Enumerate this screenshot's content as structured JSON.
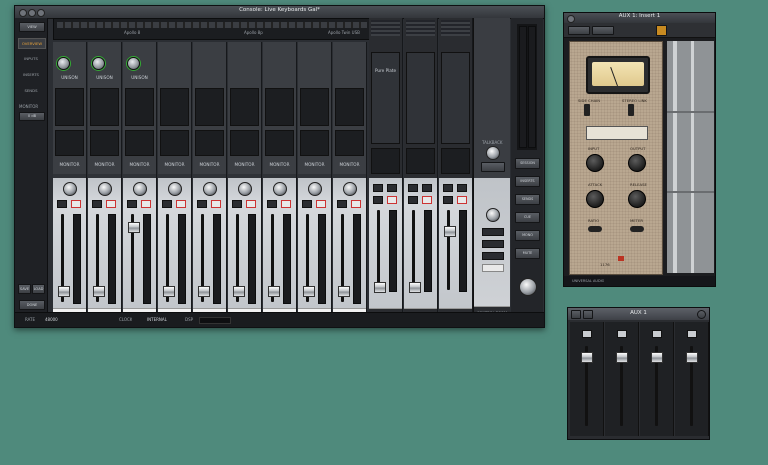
{
  "console": {
    "title": "Console: Live Keyboards Gal*",
    "left_nav": {
      "top_button": "VIEW",
      "items": [
        "OVERVIEW",
        "INPUTS",
        "INSERTS",
        "SENDS"
      ],
      "selected": "OVERVIEW",
      "monitor_label": "MONITOR",
      "monitor_value": "0 dB",
      "bottom_buttons": [
        "SAVE",
        "LOAD",
        "DONE"
      ]
    },
    "device_bar": {
      "left": "Apollo 8",
      "mid": "Apollo 8p",
      "right": "Apollo Twin USB"
    },
    "channels": [
      {
        "name": "SYNTH",
        "preset": "UNISON",
        "sends": "MONITOR",
        "has_pre": true
      },
      {
        "name": "HAMMOND",
        "preset": "UNISON",
        "sends": "MONITOR",
        "has_pre": true
      },
      {
        "name": "PIANO L",
        "preset": "UNISON",
        "sends": "MONITOR",
        "has_pre": true
      },
      {
        "name": "SYNTH",
        "preset": "",
        "sends": "MONITOR",
        "has_pre": false
      },
      {
        "name": "ANA SYNTH",
        "preset": "",
        "sends": "MONITOR",
        "has_pre": false
      },
      {
        "name": "CH 7",
        "preset": "",
        "sends": "MONITOR",
        "has_pre": false
      },
      {
        "name": "ANA SYNTH 2",
        "preset": "",
        "sends": "MONITOR",
        "has_pre": false
      },
      {
        "name": "SYNTH",
        "preset": "",
        "sends": "MONITOR",
        "has_pre": false
      },
      {
        "name": "VIRTUAL 1",
        "preset": "",
        "sends": "MONITOR",
        "has_pre": false
      }
    ],
    "aux_returns": [
      {
        "name": "AUX 1",
        "insert": "Pure Plate"
      },
      {
        "name": "AUX 2",
        "insert": ""
      },
      {
        "name": "MONITOR",
        "insert": ""
      }
    ],
    "talkback": "TALKBACK",
    "right_labels": [
      "SESSION",
      "INSERTS",
      "SENDS",
      "CUE",
      "MONO",
      "MUTE"
    ],
    "control_room": "CONTROL ROOM",
    "status": {
      "sample_rate_label": "RATE",
      "sample_rate": "48000",
      "clock_label": "CLOCK",
      "clock": "INTERNAL",
      "dsp_label": "DSP"
    }
  },
  "plugin": {
    "title": "AUX 1: Insert 1",
    "brand": "UNIVERSAL AUDIO",
    "controls": [
      {
        "label": "SIDE CHAIN",
        "value": ""
      },
      {
        "label": "STEREO LINK",
        "value": ""
      },
      {
        "label": "INPUT",
        "value": ""
      },
      {
        "label": "OUTPUT",
        "value": ""
      },
      {
        "label": "ATTACK",
        "value": ""
      },
      {
        "label": "RELEASE",
        "value": ""
      },
      {
        "label": "RATIO",
        "value": ""
      },
      {
        "label": "METER",
        "value": ""
      }
    ],
    "footer": "1176"
  },
  "aux_window": {
    "title": "AUX 1",
    "channels": 4
  }
}
